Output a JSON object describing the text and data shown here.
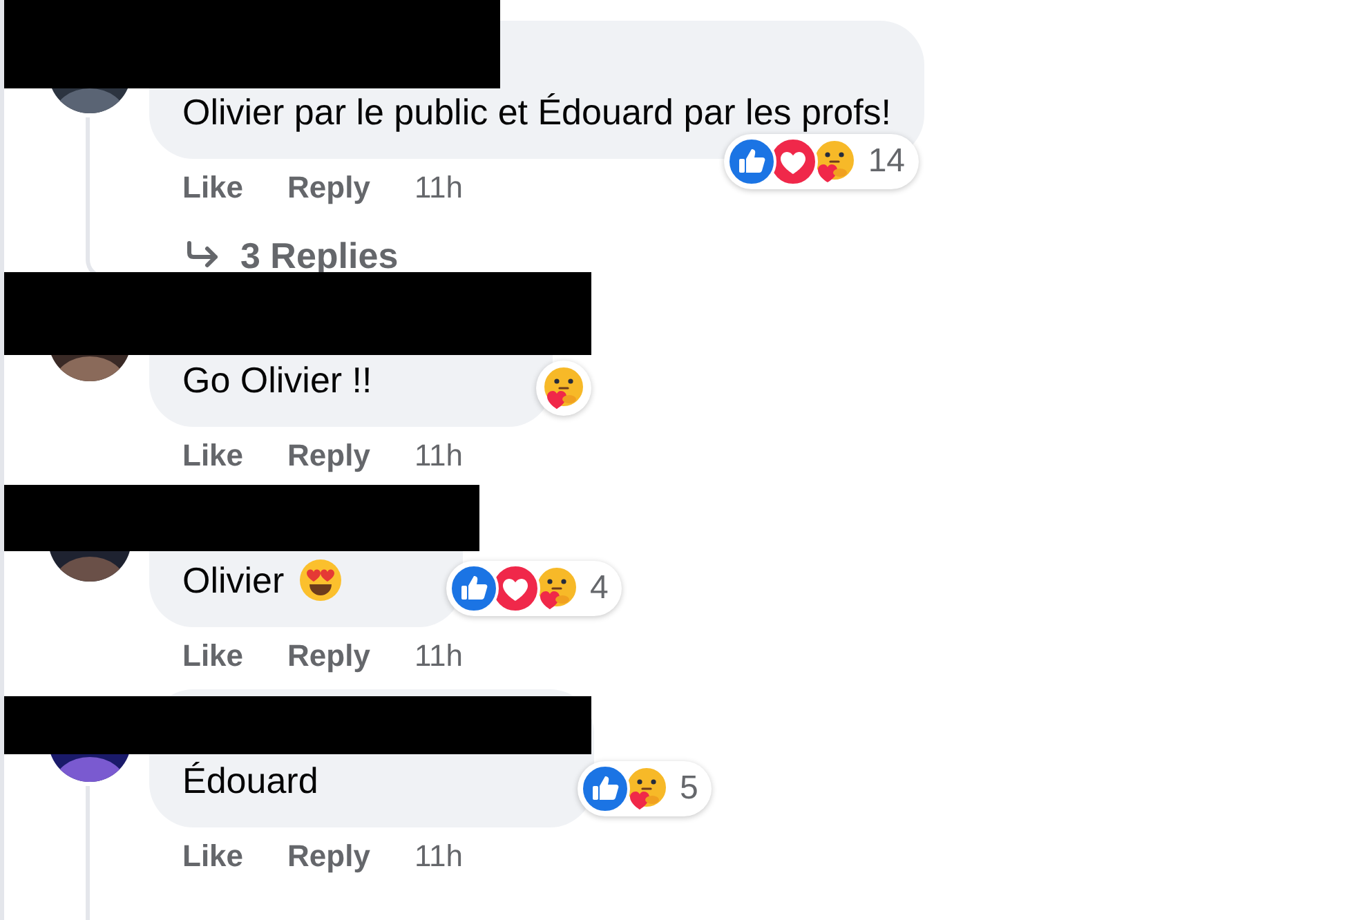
{
  "comments": [
    {
      "redacted": true,
      "text": "Olivier par le public et Édouard par les profs!",
      "reactions": [
        {
          "kind": "like"
        },
        {
          "kind": "love"
        },
        {
          "kind": "care"
        }
      ],
      "reaction_count": "14",
      "actions": {
        "like": "Like",
        "reply": "Reply",
        "time": "11h"
      },
      "replies": {
        "label": "3 Replies"
      }
    },
    {
      "redacted": true,
      "text": "Go Olivier !!",
      "reactions": [
        {
          "kind": "care"
        }
      ],
      "actions": {
        "like": "Like",
        "reply": "Reply",
        "time": "11h"
      }
    },
    {
      "redacted": true,
      "text": "Olivier",
      "emoji": {
        "kind": "heart-eyes"
      },
      "reactions": [
        {
          "kind": "like"
        },
        {
          "kind": "love"
        },
        {
          "kind": "care"
        }
      ],
      "reaction_count": "4",
      "actions": {
        "like": "Like",
        "reply": "Reply",
        "time": "11h"
      }
    },
    {
      "redacted": true,
      "text": "Édouard",
      "reactions": [
        {
          "kind": "like"
        },
        {
          "kind": "care"
        }
      ],
      "reaction_count": "5",
      "actions": {
        "like": "Like",
        "reply": "Reply",
        "time": "11h"
      },
      "thread_line": true
    }
  ]
}
